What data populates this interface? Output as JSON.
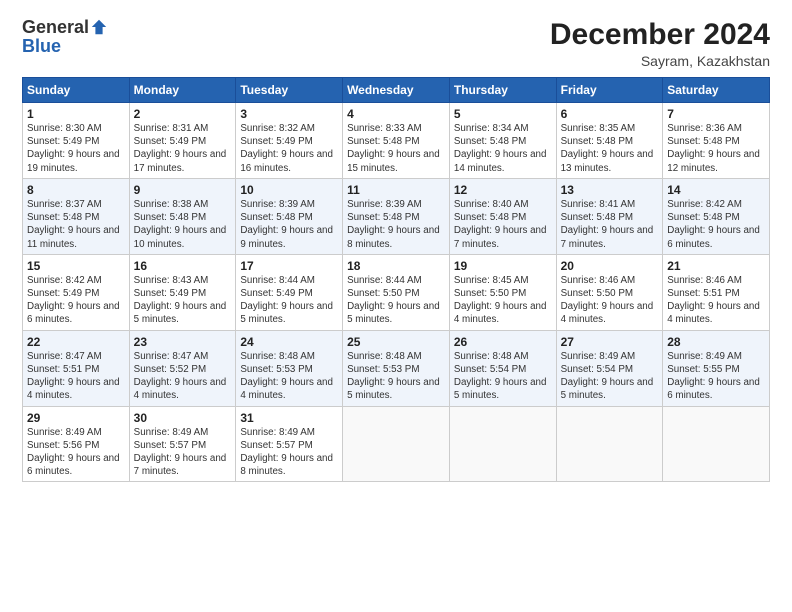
{
  "logo": {
    "general": "General",
    "blue": "Blue"
  },
  "title": "December 2024",
  "subtitle": "Sayram, Kazakhstan",
  "days_header": [
    "Sunday",
    "Monday",
    "Tuesday",
    "Wednesday",
    "Thursday",
    "Friday",
    "Saturday"
  ],
  "weeks": [
    [
      {
        "num": "1",
        "sunrise": "8:30 AM",
        "sunset": "5:49 PM",
        "daylight": "9 hours and 19 minutes."
      },
      {
        "num": "2",
        "sunrise": "8:31 AM",
        "sunset": "5:49 PM",
        "daylight": "9 hours and 17 minutes."
      },
      {
        "num": "3",
        "sunrise": "8:32 AM",
        "sunset": "5:49 PM",
        "daylight": "9 hours and 16 minutes."
      },
      {
        "num": "4",
        "sunrise": "8:33 AM",
        "sunset": "5:48 PM",
        "daylight": "9 hours and 15 minutes."
      },
      {
        "num": "5",
        "sunrise": "8:34 AM",
        "sunset": "5:48 PM",
        "daylight": "9 hours and 14 minutes."
      },
      {
        "num": "6",
        "sunrise": "8:35 AM",
        "sunset": "5:48 PM",
        "daylight": "9 hours and 13 minutes."
      },
      {
        "num": "7",
        "sunrise": "8:36 AM",
        "sunset": "5:48 PM",
        "daylight": "9 hours and 12 minutes."
      }
    ],
    [
      {
        "num": "8",
        "sunrise": "8:37 AM",
        "sunset": "5:48 PM",
        "daylight": "9 hours and 11 minutes."
      },
      {
        "num": "9",
        "sunrise": "8:38 AM",
        "sunset": "5:48 PM",
        "daylight": "9 hours and 10 minutes."
      },
      {
        "num": "10",
        "sunrise": "8:39 AM",
        "sunset": "5:48 PM",
        "daylight": "9 hours and 9 minutes."
      },
      {
        "num": "11",
        "sunrise": "8:39 AM",
        "sunset": "5:48 PM",
        "daylight": "9 hours and 8 minutes."
      },
      {
        "num": "12",
        "sunrise": "8:40 AM",
        "sunset": "5:48 PM",
        "daylight": "9 hours and 7 minutes."
      },
      {
        "num": "13",
        "sunrise": "8:41 AM",
        "sunset": "5:48 PM",
        "daylight": "9 hours and 7 minutes."
      },
      {
        "num": "14",
        "sunrise": "8:42 AM",
        "sunset": "5:48 PM",
        "daylight": "9 hours and 6 minutes."
      }
    ],
    [
      {
        "num": "15",
        "sunrise": "8:42 AM",
        "sunset": "5:49 PM",
        "daylight": "9 hours and 6 minutes."
      },
      {
        "num": "16",
        "sunrise": "8:43 AM",
        "sunset": "5:49 PM",
        "daylight": "9 hours and 5 minutes."
      },
      {
        "num": "17",
        "sunrise": "8:44 AM",
        "sunset": "5:49 PM",
        "daylight": "9 hours and 5 minutes."
      },
      {
        "num": "18",
        "sunrise": "8:44 AM",
        "sunset": "5:50 PM",
        "daylight": "9 hours and 5 minutes."
      },
      {
        "num": "19",
        "sunrise": "8:45 AM",
        "sunset": "5:50 PM",
        "daylight": "9 hours and 4 minutes."
      },
      {
        "num": "20",
        "sunrise": "8:46 AM",
        "sunset": "5:50 PM",
        "daylight": "9 hours and 4 minutes."
      },
      {
        "num": "21",
        "sunrise": "8:46 AM",
        "sunset": "5:51 PM",
        "daylight": "9 hours and 4 minutes."
      }
    ],
    [
      {
        "num": "22",
        "sunrise": "8:47 AM",
        "sunset": "5:51 PM",
        "daylight": "9 hours and 4 minutes."
      },
      {
        "num": "23",
        "sunrise": "8:47 AM",
        "sunset": "5:52 PM",
        "daylight": "9 hours and 4 minutes."
      },
      {
        "num": "24",
        "sunrise": "8:48 AM",
        "sunset": "5:53 PM",
        "daylight": "9 hours and 4 minutes."
      },
      {
        "num": "25",
        "sunrise": "8:48 AM",
        "sunset": "5:53 PM",
        "daylight": "9 hours and 5 minutes."
      },
      {
        "num": "26",
        "sunrise": "8:48 AM",
        "sunset": "5:54 PM",
        "daylight": "9 hours and 5 minutes."
      },
      {
        "num": "27",
        "sunrise": "8:49 AM",
        "sunset": "5:54 PM",
        "daylight": "9 hours and 5 minutes."
      },
      {
        "num": "28",
        "sunrise": "8:49 AM",
        "sunset": "5:55 PM",
        "daylight": "9 hours and 6 minutes."
      }
    ],
    [
      {
        "num": "29",
        "sunrise": "8:49 AM",
        "sunset": "5:56 PM",
        "daylight": "9 hours and 6 minutes."
      },
      {
        "num": "30",
        "sunrise": "8:49 AM",
        "sunset": "5:57 PM",
        "daylight": "9 hours and 7 minutes."
      },
      {
        "num": "31",
        "sunrise": "8:49 AM",
        "sunset": "5:57 PM",
        "daylight": "9 hours and 8 minutes."
      },
      null,
      null,
      null,
      null
    ]
  ]
}
